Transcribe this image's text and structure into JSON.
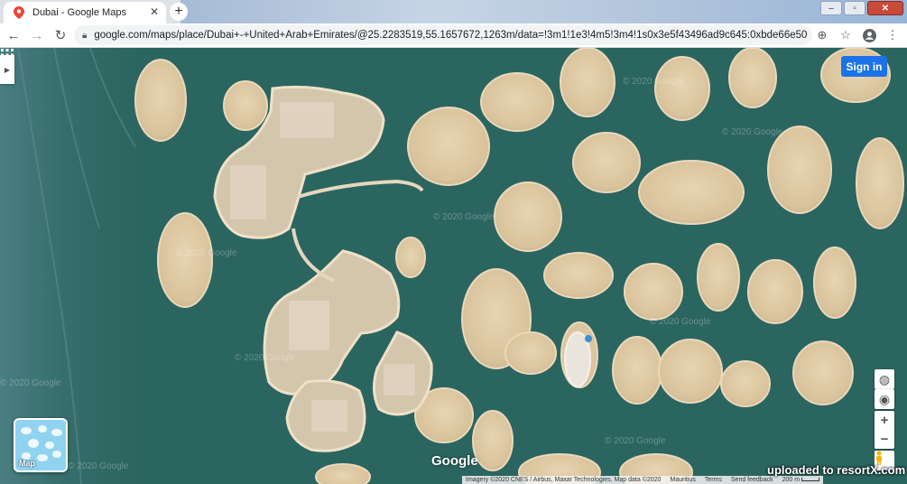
{
  "browser": {
    "tab_title": "Dubai - Google Maps",
    "tab_close": "✕",
    "new_tab": "+",
    "url": "google.com/maps/place/Dubai+-+United+Arab+Emirates/@25.2283519,55.1657672,1263m/data=!3m1!1e3!4m5!3m4!1s0x3e5f43496ad9c645:0xbde66e5084295162!8m2!3...",
    "window_controls": [
      "–",
      "▫",
      "✕"
    ]
  },
  "map": {
    "signin_label": "Sign in",
    "layer_label": "Map",
    "logo": "Google",
    "watermark": "© 2020 Google",
    "attribution": "Imagery ©2020 CNES / Airbus, Maxar Technologies, Map data ©2020",
    "region": "Mauritius",
    "terms": "Terms",
    "feedback": "Send feedback",
    "scale_label": "200 m",
    "zoom_in": "+",
    "zoom_out": "−",
    "colors": {
      "water": "#2d6660",
      "sand": "#dcc8a4",
      "button": "#1a73e8"
    }
  },
  "overlay": {
    "watermark_text": "uploaded to resortX.com"
  }
}
